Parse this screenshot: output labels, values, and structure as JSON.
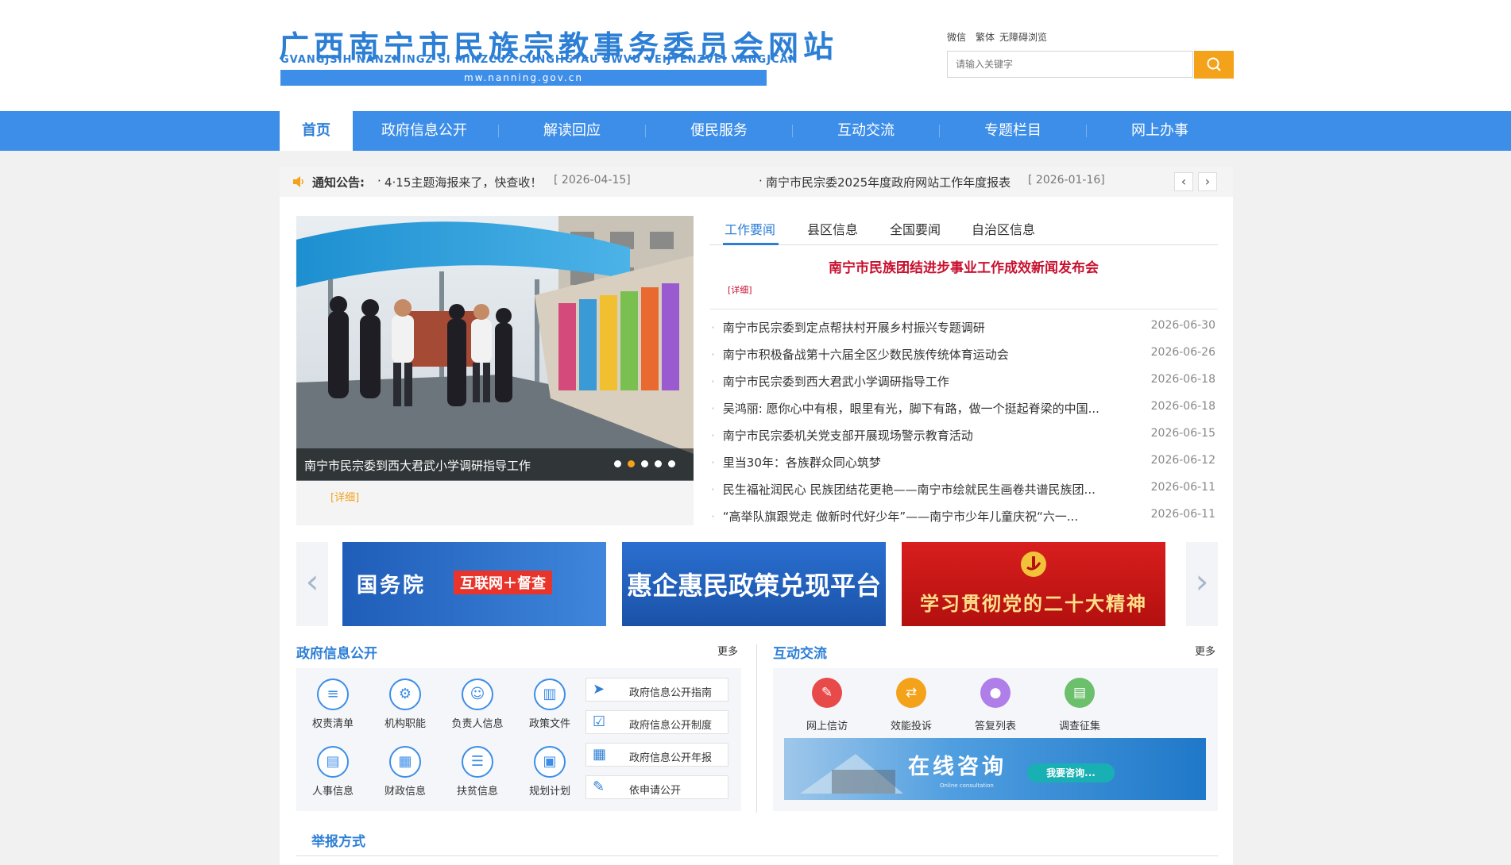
{
  "header": {
    "title": "广西南宁市民族宗教事务委员会网站",
    "subtitle": "GVANGJSIH NANZNINGZ SI MINZCUZ CUNGHGYAU SWVU VEIJYENZVEI VANGJCAN",
    "url": "mw.nanning.gov.cn",
    "links": [
      "微信",
      "繁体",
      "无障碍浏览"
    ],
    "search_placeholder": "请输入关键字"
  },
  "nav": {
    "items": [
      "首页",
      "政府信息公开",
      "解读回应",
      "便民服务",
      "互动交流",
      "专题栏目",
      "网上办事"
    ],
    "active": "首页"
  },
  "notice": {
    "label": "通知公告:",
    "items": [
      {
        "text": "4·15主题海报来了，快查收！",
        "date": "[ 2026-04-15]"
      },
      {
        "text": "南宁市民宗委2025年度政府网站工作年度报表",
        "date": "[ 2026-01-16]"
      }
    ],
    "bullet": "·",
    "prev": "‹",
    "next": "›"
  },
  "slider": {
    "caption": "南宁市民宗委到西大君武小学调研指导工作",
    "detail": "[详细]",
    "dots": 5,
    "active_dot": 1
  },
  "news": {
    "tabs": [
      "工作要闻",
      "县区信息",
      "全国要闻",
      "自治区信息"
    ],
    "active_tab": "工作要闻",
    "headline": "南宁市民族团结进步事业工作成效新闻发布会",
    "headline_detail": "[详细]",
    "bullet": "·",
    "items": [
      {
        "title": "南宁市民宗委到定点帮扶村开展乡村振兴专题调研",
        "date": "2026-06-30"
      },
      {
        "title": "南宁市积极备战第十六届全区少数民族传统体育运动会",
        "date": "2026-06-26"
      },
      {
        "title": "南宁市民宗委到西大君武小学调研指导工作",
        "date": "2026-06-18"
      },
      {
        "title": "吴鸿丽: 愿你心中有根，眼里有光，脚下有路，做一个挺起脊梁的中国...",
        "date": "2026-06-18"
      },
      {
        "title": "南宁市民宗委机关党支部开展现场警示教育活动",
        "date": "2026-06-15"
      },
      {
        "title": "里当30年：各族群众同心筑梦",
        "date": "2026-06-12"
      },
      {
        "title": "民生福祉润民心 民族团结花更艳——南宁市绘就民生画卷共谱民族团...",
        "date": "2026-06-11"
      },
      {
        "title": "“高举队旗跟党走 做新时代好少年”——南宁市少年儿童庆祝“六一...",
        "date": "2026-06-11"
      }
    ]
  },
  "banners": {
    "prev": "‹",
    "next": "›",
    "items": [
      {
        "text": "国务院",
        "tag": "互联网＋督查"
      },
      {
        "text": "惠企惠民政策兑现平台"
      },
      {
        "text": "学习贯彻党的二十大精神"
      }
    ]
  },
  "gov_info": {
    "title": "政府信息公开",
    "more": "更多",
    "icons": [
      {
        "label": "权责清单",
        "icon": "list-icon"
      },
      {
        "label": "机构职能",
        "icon": "gear-icon"
      },
      {
        "label": "负责人信息",
        "icon": "person-icon"
      },
      {
        "label": "政策文件",
        "icon": "chart-icon"
      },
      {
        "label": "人事信息",
        "icon": "id-card-icon"
      },
      {
        "label": "财政信息",
        "icon": "ledger-icon"
      },
      {
        "label": "扶贫信息",
        "icon": "bullet-list-icon"
      },
      {
        "label": "规划计划",
        "icon": "book-icon"
      }
    ],
    "links": [
      {
        "label": "政府信息公开指南",
        "icon": "cursor-icon"
      },
      {
        "label": "政府信息公开制度",
        "icon": "document-check-icon"
      },
      {
        "label": "政府信息公开年报",
        "icon": "calendar-icon"
      },
      {
        "label": "依申请公开",
        "icon": "edit-icon"
      }
    ]
  },
  "interaction": {
    "title": "互动交流",
    "more": "更多",
    "icons": [
      {
        "label": "网上信访",
        "color": "#e84a4a",
        "icon": "edit-icon"
      },
      {
        "label": "效能投诉",
        "color": "#f5a21b",
        "icon": "shuffle-icon"
      },
      {
        "label": "答复列表",
        "color": "#b07ee8",
        "icon": "microphone-icon"
      },
      {
        "label": "调查征集",
        "color": "#6cc06c",
        "icon": "document-icon"
      }
    ],
    "consult_title": "在线咨询",
    "consult_sub": "Online consultation",
    "consult_button": "我要咨询..."
  },
  "report": {
    "title": "举报方式"
  },
  "colors": {
    "primary": "#3d8ee8",
    "accent": "#f5a21b",
    "headline": "#c8102e"
  }
}
